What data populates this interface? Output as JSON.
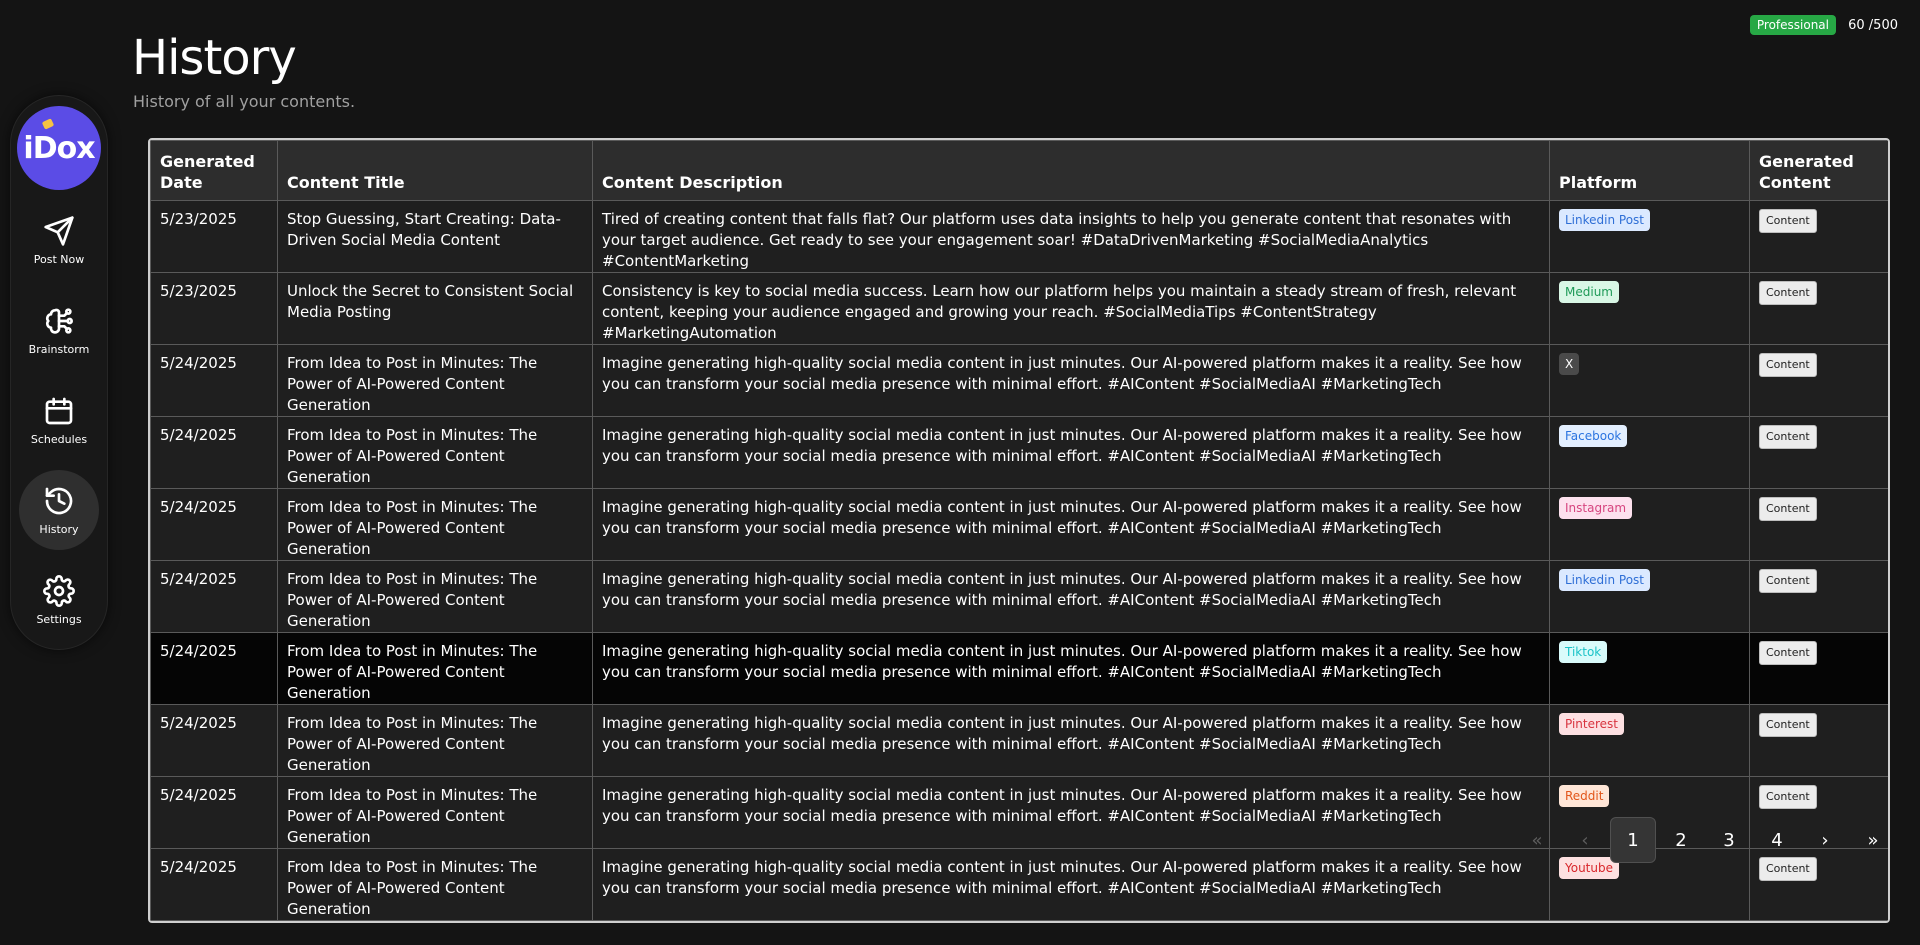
{
  "header": {
    "title": "History",
    "subtitle": "History of all your contents.",
    "plan": "Professional",
    "credits": "60 /500"
  },
  "sidebar": {
    "items": [
      {
        "label": "Post Now",
        "icon": "send-icon"
      },
      {
        "label": "Brainstorm",
        "icon": "brain-icon"
      },
      {
        "label": "Schedules",
        "icon": "calendar-icon"
      },
      {
        "label": "History",
        "icon": "history-icon",
        "active": true
      },
      {
        "label": "Settings",
        "icon": "gear-icon"
      }
    ]
  },
  "table": {
    "columns": [
      "Generated Date",
      "Content Title",
      "Content Description",
      "Platform",
      "Generated Content"
    ],
    "content_button_label": "Content",
    "rows": [
      {
        "date": "5/23/2025",
        "title": "Stop Guessing, Start Creating: Data-Driven Social Media Content",
        "description": "Tired of creating content that falls flat? Our platform uses data insights to help you generate content that resonates with your target audience. Get ready to see your engagement soar! #DataDrivenMarketing #SocialMediaAnalytics #ContentMarketing",
        "platform": "Linkedin Post"
      },
      {
        "date": "5/23/2025",
        "title": "Unlock the Secret to Consistent Social Media Posting",
        "description": "Consistency is key to social media success. Learn how our platform helps you maintain a steady stream of fresh, relevant content, keeping your audience engaged and growing your reach. #SocialMediaTips #ContentStrategy #MarketingAutomation",
        "platform": "Medium"
      },
      {
        "date": "5/24/2025",
        "title": "From Idea to Post in Minutes: The Power of AI-Powered Content Generation",
        "description": "Imagine generating high-quality social media content in just minutes. Our AI-powered platform makes it a reality. See how you can transform your social media presence with minimal effort. #AIContent #SocialMediaAI #MarketingTech",
        "platform": "X"
      },
      {
        "date": "5/24/2025",
        "title": "From Idea to Post in Minutes: The Power of AI-Powered Content Generation",
        "description": "Imagine generating high-quality social media content in just minutes. Our AI-powered platform makes it a reality. See how you can transform your social media presence with minimal effort. #AIContent #SocialMediaAI #MarketingTech",
        "platform": "Facebook"
      },
      {
        "date": "5/24/2025",
        "title": "From Idea to Post in Minutes: The Power of AI-Powered Content Generation",
        "description": "Imagine generating high-quality social media content in just minutes. Our AI-powered platform makes it a reality. See how you can transform your social media presence with minimal effort. #AIContent #SocialMediaAI #MarketingTech",
        "platform": "Instagram"
      },
      {
        "date": "5/24/2025",
        "title": "From Idea to Post in Minutes: The Power of AI-Powered Content Generation",
        "description": "Imagine generating high-quality social media content in just minutes. Our AI-powered platform makes it a reality. See how you can transform your social media presence with minimal effort. #AIContent #SocialMediaAI #MarketingTech",
        "platform": "Linkedin Post"
      },
      {
        "date": "5/24/2025",
        "title": "From Idea to Post in Minutes: The Power of AI-Powered Content Generation",
        "description": "Imagine generating high-quality social media content in just minutes. Our AI-powered platform makes it a reality. See how you can transform your social media presence with minimal effort. #AIContent #SocialMediaAI #MarketingTech",
        "platform": "Tiktok"
      },
      {
        "date": "5/24/2025",
        "title": "From Idea to Post in Minutes: The Power of AI-Powered Content Generation",
        "description": "Imagine generating high-quality social media content in just minutes. Our AI-powered platform makes it a reality. See how you can transform your social media presence with minimal effort. #AIContent #SocialMediaAI #MarketingTech",
        "platform": "Pinterest"
      },
      {
        "date": "5/24/2025",
        "title": "From Idea to Post in Minutes: The Power of AI-Powered Content Generation",
        "description": "Imagine generating high-quality social media content in just minutes. Our AI-powered platform makes it a reality. See how you can transform your social media presence with minimal effort. #AIContent #SocialMediaAI #MarketingTech",
        "platform": "Reddit"
      },
      {
        "date": "5/24/2025",
        "title": "From Idea to Post in Minutes: The Power of AI-Powered Content Generation",
        "description": "Imagine generating high-quality social media content in just minutes. Our AI-powered platform makes it a reality. See how you can transform your social media presence with minimal effort. #AIContent #SocialMediaAI #MarketingTech",
        "platform": "Youtube"
      }
    ]
  },
  "platform_colors": {
    "Linkedin Post": {
      "bg": "#dbe9ff",
      "fg": "#2f6fd6"
    },
    "Medium": {
      "bg": "#d9f7e6",
      "fg": "#1f9a58"
    },
    "X": {
      "bg": "#4a4a4a",
      "fg": "#ffffff"
    },
    "Facebook": {
      "bg": "#e3efff",
      "fg": "#2b74e0"
    },
    "Instagram": {
      "bg": "#fde1ee",
      "fg": "#d6457f"
    },
    "Tiktok": {
      "bg": "#d9fbfb",
      "fg": "#1cc3c8"
    },
    "Pinterest": {
      "bg": "#fde0e2",
      "fg": "#d8343f"
    },
    "Reddit": {
      "bg": "#ffe6d7",
      "fg": "#e2561a"
    },
    "Youtube": {
      "bg": "#fde0e0",
      "fg": "#d8262b"
    }
  },
  "pagination": {
    "first": "«",
    "prev": "‹",
    "pages": [
      "1",
      "2",
      "3",
      "4"
    ],
    "current": "1",
    "next": "›",
    "last": "»"
  }
}
